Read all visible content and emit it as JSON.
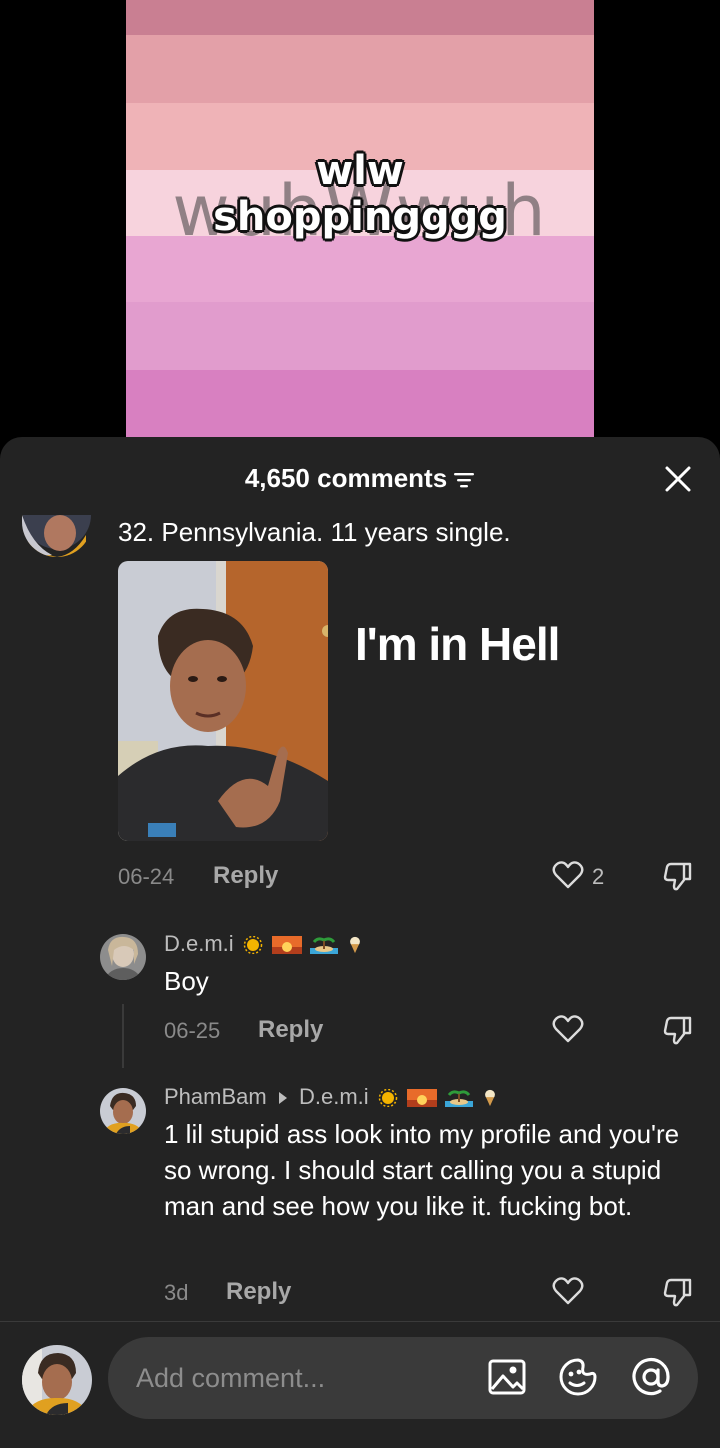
{
  "video": {
    "background_text": "wuhWwuh",
    "caption_line1": "wlw",
    "caption_line2": "shoppingggg",
    "stripes": [
      "#c97f92",
      "#e3a0a8",
      "#efb3b7",
      "#f7d3dd",
      "#e8a6d2",
      "#e19ccd",
      "#d880c1"
    ]
  },
  "panel": {
    "comment_count": "4,650 comments",
    "filter_icon": "filter-icon",
    "close_icon": "close-icon"
  },
  "main_comment": {
    "text": "32. Pennsylvania. 11 years single.",
    "sticker_text": "I'm in Hell",
    "date": "06-24",
    "reply_label": "Reply",
    "like_count": "2"
  },
  "replies": [
    {
      "username": "D.e.m.i",
      "emojis": [
        "sun",
        "sunset",
        "island",
        "ice-cream"
      ],
      "text": "Boy",
      "date": "06-25",
      "reply_label": "Reply"
    },
    {
      "username": "PhamBam",
      "reply_to": "D.e.m.i",
      "emojis": [
        "sun",
        "sunset",
        "island",
        "ice-cream"
      ],
      "text": "1 lil stupid ass look into my profile and you're so wrong. I should start calling you a stupid man and see how you like it. fucking bot.",
      "date": "3d",
      "reply_label": "Reply"
    }
  ],
  "composer": {
    "placeholder": "Add comment...",
    "icons": [
      "image-icon",
      "emoji-icon",
      "mention-icon"
    ]
  },
  "colors": {
    "panel_bg": "#232323",
    "input_bg": "#3a3a3a",
    "muted_text": "#8a8a8a"
  }
}
